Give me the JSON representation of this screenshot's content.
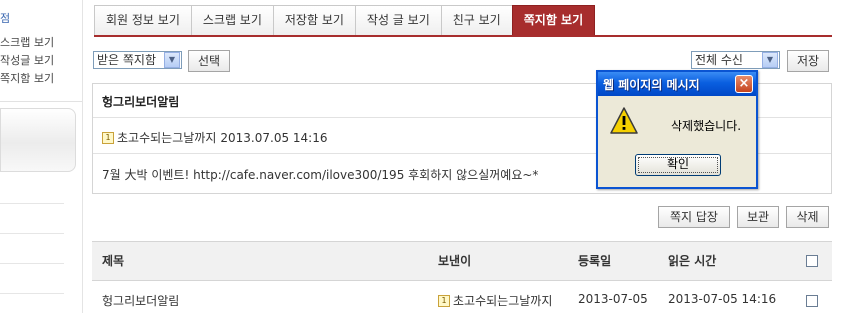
{
  "sidebar": {
    "header": "점",
    "items": [
      {
        "label": "스크랩 보기"
      },
      {
        "label": "작성글 보기"
      },
      {
        "label": "쪽지함 보기"
      }
    ]
  },
  "tabs": [
    {
      "label": "회원 정보 보기",
      "active": false
    },
    {
      "label": "스크랩 보기",
      "active": false
    },
    {
      "label": "저장함 보기",
      "active": false
    },
    {
      "label": "작성 글 보기",
      "active": false
    },
    {
      "label": "친구 보기",
      "active": false
    },
    {
      "label": "쪽지함 보기",
      "active": true
    }
  ],
  "toolbar": {
    "box_select_value": "받은 쪽지함",
    "select_button": "선택",
    "filter_select_value": "전체 수신",
    "save_button": "저장"
  },
  "message": {
    "title": "헝그리보더알림",
    "sender": "초고수되는그날까지",
    "date": "2013.07.05 14:16",
    "body": "7월 大박 이벤트! http://cafe.naver.com/ilove300/195 후회하지 않으실꺼예요~*"
  },
  "actions": {
    "reply": "쪽지 답장",
    "keep": "보관",
    "delete": "삭제"
  },
  "table": {
    "headers": {
      "subject": "제목",
      "sender": "보낸이",
      "registered": "등록일",
      "read_time": "읽은 시간"
    },
    "rows": [
      {
        "subject": "헝그리보더알림",
        "sender": "초고수되는그날까지",
        "registered": "2013-07-05",
        "read_time": "2013-07-05 14:16"
      }
    ]
  },
  "dialog": {
    "title": "웹 페이지의 메시지",
    "message": "삭제했습니다.",
    "ok": "확인",
    "close": "×",
    "icon": "warning-icon"
  },
  "colors": {
    "active_tab": "#a72d2d",
    "dialog_title_bar": "#0a5fe0",
    "dialog_body": "#ece9d8"
  }
}
